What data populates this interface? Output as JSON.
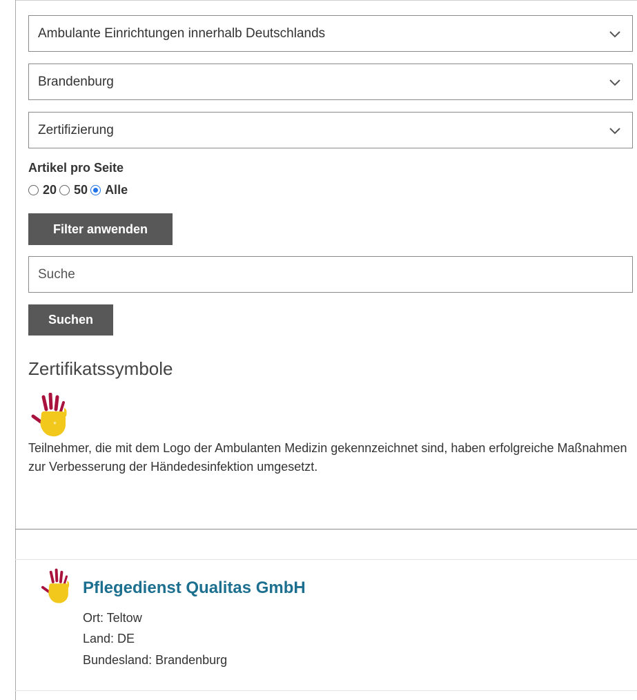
{
  "filters": {
    "select_region": "Ambulante Einrichtungen innerhalb Deutschlands",
    "select_state": "Brandenburg",
    "select_type": "Zertifizierung"
  },
  "pagination": {
    "label": "Artikel pro Seite",
    "options": [
      "20",
      "50",
      "Alle"
    ],
    "selected": "Alle"
  },
  "buttons": {
    "apply_filter": "Filter anwenden",
    "search": "Suchen"
  },
  "search": {
    "placeholder": "Suche"
  },
  "symbols": {
    "title": "Zertifikatssymbole",
    "icon": "hand-print-logo-icon",
    "description": "Teilnehmer, die mit dem Logo der Ambulanten Medizin gekennzeichnet sind, haben erfolgreiche Maßnahmen zur Verbesserung der Händedesinfektion umgesetzt."
  },
  "results": [
    {
      "name": "Pflegedienst Qualitas GmbH",
      "ort": "Ort: Teltow",
      "land": "Land: DE",
      "bundesland": "Bundesland: Brandenburg",
      "icon": "hand-print-logo-icon"
    }
  ],
  "colors": {
    "button_bg": "#585858",
    "link_title": "#1c6f8f",
    "radio_checked": "#1f72e8",
    "hand_yellow": "#f2c81c",
    "hand_red": "#a8123c"
  }
}
